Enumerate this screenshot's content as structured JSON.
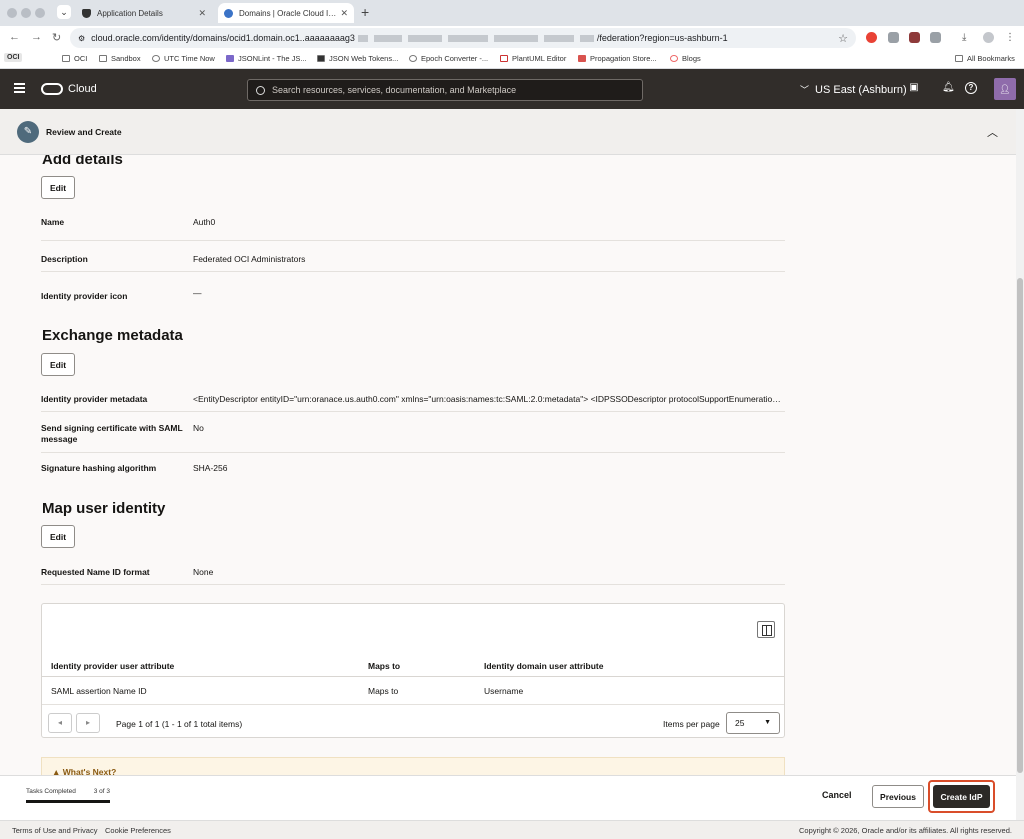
{
  "browser": {
    "tabs": [
      {
        "label": "Application Details",
        "active": false
      },
      {
        "label": "Domains | Oracle Cloud Infrast",
        "active": true
      }
    ],
    "url": {
      "prefix": "cloud.oracle.com/identity/domains/ocid1.domain.oc1..aaaaaaaag3",
      "suffix": "/federation?region=us-ashburn-1"
    },
    "bookmarks": {
      "badge": "OCI",
      "items": [
        "OCI",
        "Sandbox",
        "UTC Time Now",
        "JSONLint - The JS...",
        "JSON Web Tokens...",
        "Epoch Converter -...",
        "PlantUML Editor",
        "Propagation Store...",
        "Blogs"
      ],
      "all": "All Bookmarks"
    }
  },
  "header": {
    "product": "Cloud",
    "search_placeholder": "Search resources, services, documentation, and Marketplace",
    "region": "US East (Ashburn)"
  },
  "step": {
    "label": "Review and Create"
  },
  "sections": {
    "add_details": {
      "title": "Add details",
      "edit": "Edit",
      "rows": [
        {
          "key": "Name",
          "value": "Auth0"
        },
        {
          "key": "Description",
          "value": "Federated OCI Administrators"
        },
        {
          "key": "Identity provider icon",
          "value": "—"
        }
      ]
    },
    "exchange_metadata": {
      "title": "Exchange metadata",
      "edit": "Edit",
      "rows": [
        {
          "key": "Identity provider metadata",
          "value": "<EntityDescriptor entityID=\"urn:oranace.us.auth0.com\" xmlns=\"urn:oasis:names:tc:SAML:2.0:metadata\"> <IDPSSODescriptor protocolSupportEnumeration=\"urn:oasis:names:tc:SAML:2.0:protocol\">"
        },
        {
          "key": "Send signing certificate with SAML message",
          "value": "No"
        },
        {
          "key": "Signature hashing algorithm",
          "value": "SHA-256"
        }
      ]
    },
    "map_identity": {
      "title": "Map user identity",
      "edit": "Edit",
      "rows": [
        {
          "key": "Requested Name ID format",
          "value": "None"
        }
      ]
    }
  },
  "table": {
    "columns": [
      "Identity provider user attribute",
      "Maps to",
      "Identity domain user attribute"
    ],
    "rows": [
      [
        "SAML assertion Name ID",
        "Maps to",
        "Username"
      ]
    ],
    "pagination": "Page 1 of 1 (1 - 1 of 1 total items)",
    "items_per_page_label": "Items per page",
    "items_per_page": "25"
  },
  "whats_next": "What's Next?",
  "footer": {
    "tasks_label": "Tasks Completed",
    "tasks_count": "3 of 3",
    "progress": 1.0,
    "cancel": "Cancel",
    "previous": "Previous",
    "create": "Create IdP",
    "terms": "Terms of Use and Privacy",
    "cookies": "Cookie Preferences",
    "copyright": "Copyright © 2026, Oracle and/or its affiliates. All rights reserved."
  }
}
